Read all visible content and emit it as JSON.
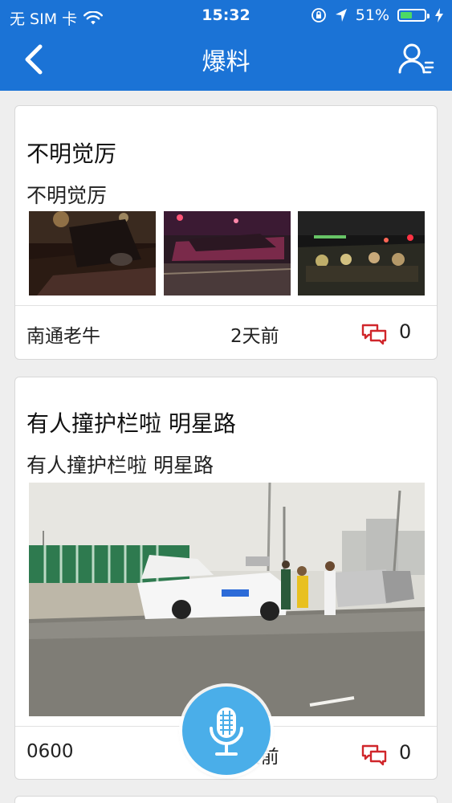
{
  "status_bar": {
    "carrier": "无 SIM 卡",
    "time": "15:32",
    "battery_percent": "51%",
    "battery_level": 0.51,
    "icons": [
      "wifi-icon",
      "orientation-lock-icon",
      "location-arrow-icon",
      "battery-icon",
      "charging-icon"
    ]
  },
  "nav": {
    "title": "爆料",
    "back_icon": "chevron-left-icon",
    "profile_icon": "user-icon"
  },
  "posts": [
    {
      "title": "不明觉厉",
      "subtitle": "不明觉厉",
      "images": [
        "night-street-photo-1",
        "night-street-photo-2",
        "night-street-photo-3"
      ],
      "author": "南通老牛",
      "time": "2天前",
      "comment_count": "0"
    },
    {
      "title": "有人撞护栏啦 明星路",
      "subtitle": "有人撞护栏啦 明星路",
      "images": [
        "car-accident-photo"
      ],
      "author": "0600",
      "time": "2天前",
      "comment_count": "0"
    }
  ],
  "mic_button": {
    "icon": "microphone-icon"
  },
  "colors": {
    "header": "#1b73d6",
    "background": "#eeeeee",
    "mic": "#4aaee9",
    "comment_icon": "#d0262b",
    "battery": "#4cd964"
  }
}
